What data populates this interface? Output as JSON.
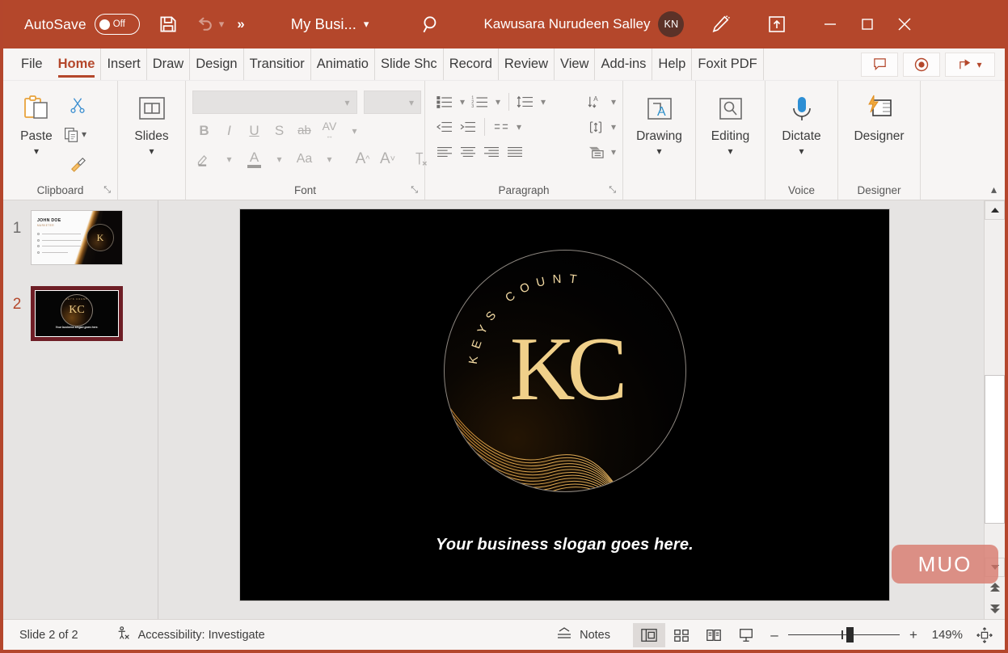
{
  "titlebar": {
    "autosave_label": "AutoSave",
    "autosave_state": "Off",
    "save_icon": "save-icon",
    "undo_icon": "undo-icon",
    "more_commands": "»",
    "document_title": "My Busi...",
    "search_icon": "search-icon",
    "user_name": "Kawusara Nurudeen Salley",
    "avatar_initials": "KN",
    "pen_icon": "pen-highlighter-icon",
    "share_icon": "share-upload-icon",
    "minimize": "–",
    "maximize": "□",
    "close": "✕",
    "accent_color": "#b4472b"
  },
  "tabs": [
    {
      "label": "File",
      "active": false
    },
    {
      "label": "Home",
      "active": true
    },
    {
      "label": "Insert",
      "active": false
    },
    {
      "label": "Draw",
      "active": false
    },
    {
      "label": "Design",
      "active": false
    },
    {
      "label": "Transitior",
      "active": false
    },
    {
      "label": "Animatio",
      "active": false
    },
    {
      "label": "Slide Shc",
      "active": false
    },
    {
      "label": "Record",
      "active": false
    },
    {
      "label": "Review",
      "active": false
    },
    {
      "label": "View",
      "active": false
    },
    {
      "label": "Add-ins",
      "active": false
    },
    {
      "label": "Help",
      "active": false
    },
    {
      "label": "Foxit PDF",
      "active": false
    }
  ],
  "tab_right_buttons": [
    {
      "name": "comments-button",
      "icon": "comment-icon"
    },
    {
      "name": "record-button",
      "icon": "record-circle-icon"
    },
    {
      "name": "share-button",
      "icon": "share-arrow-icon"
    }
  ],
  "ribbon": {
    "clipboard": {
      "group_label": "Clipboard",
      "paste_label": "Paste",
      "paste_icon": "clipboard-paste-icon",
      "cut_icon": "scissors-icon",
      "copy_icon": "copy-icon",
      "format_painter_icon": "format-painter-icon",
      "dialog_launcher": "⤡"
    },
    "slides": {
      "group_label": "",
      "slides_label": "Slides",
      "slides_icon": "new-slide-icon"
    },
    "font": {
      "group_label": "Font",
      "font_name_value": "",
      "font_size_value": "",
      "bold": "B",
      "italic": "I",
      "underline": "U",
      "shadow": "S",
      "strikethrough": "ab",
      "char_spacing": "AV",
      "text_highlight_icon": "text-highlight-icon",
      "font_color_icon": "font-color-icon",
      "change_case": "Aa",
      "increase_size": "A",
      "decrease_size": "A",
      "clear_formatting_icon": "clear-formatting-icon",
      "dialog_launcher": "⤡",
      "disabled": true
    },
    "paragraph": {
      "group_label": "Paragraph",
      "bullets_icon": "bullets-icon",
      "numbering_icon": "numbering-icon",
      "line_spacing_icon": "line-spacing-icon",
      "text_direction_icon": "text-direction-icon",
      "decrease_indent_icon": "decrease-indent-icon",
      "increase_indent_icon": "increase-indent-icon",
      "columns_icon": "columns-icon",
      "align_text_icon": "align-text-vertical-icon",
      "align_left_icon": "align-left-icon",
      "align_center_icon": "align-center-icon",
      "align_right_icon": "align-right-icon",
      "justify_icon": "justify-icon",
      "smartart_icon": "convert-to-smartart-icon",
      "dialog_launcher": "⤡"
    },
    "drawing": {
      "label": "Drawing",
      "icon": "text-box-shape-icon"
    },
    "editing": {
      "label": "Editing",
      "icon": "find-magnifier-icon"
    },
    "voice": {
      "group_label": "Voice",
      "dictate_label": "Dictate",
      "icon": "microphone-icon"
    },
    "designer": {
      "group_label": "Designer",
      "label": "Designer",
      "icon": "designer-lightning-icon"
    },
    "collapse_icon": "collapse-ribbon-chevron-icon"
  },
  "thumbnails": [
    {
      "number": "1",
      "selected": false,
      "title": "JOHN DOE",
      "subtitle": "MARKETER"
    },
    {
      "number": "2",
      "selected": true,
      "slogan": "Your business slogan goes here."
    }
  ],
  "slide": {
    "logo_arc_text": "KEYS COUNT",
    "logo_monogram": "KC",
    "slogan": "Your business slogan goes here.",
    "background_color": "#000000",
    "gold_color": "#f0d08a"
  },
  "scrollbar": {
    "up_icon": "scroll-up-arrow-icon",
    "down_icon": "scroll-down-arrow-icon",
    "prev_slide_icon": "previous-slide-double-arrow-icon",
    "next_slide_icon": "next-slide-double-arrow-icon"
  },
  "statusbar": {
    "slide_count": "Slide 2 of 2",
    "accessibility": "Accessibility: Investigate",
    "accessibility_icon": "accessibility-person-icon",
    "notes_label": "Notes",
    "notes_icon": "notes-caret-icon",
    "views": [
      {
        "name": "normal-view-button",
        "icon": "normal-view-icon",
        "active": true
      },
      {
        "name": "slide-sorter-button",
        "icon": "slide-sorter-icon",
        "active": false
      },
      {
        "name": "reading-view-button",
        "icon": "reading-view-icon",
        "active": false
      },
      {
        "name": "slide-show-button",
        "icon": "slide-show-icon",
        "active": false
      }
    ],
    "zoom_out": "–",
    "zoom_in": "+",
    "zoom_percent": "149%",
    "fit_icon": "fit-slide-to-window-icon"
  },
  "watermark": {
    "text": "MUO"
  }
}
